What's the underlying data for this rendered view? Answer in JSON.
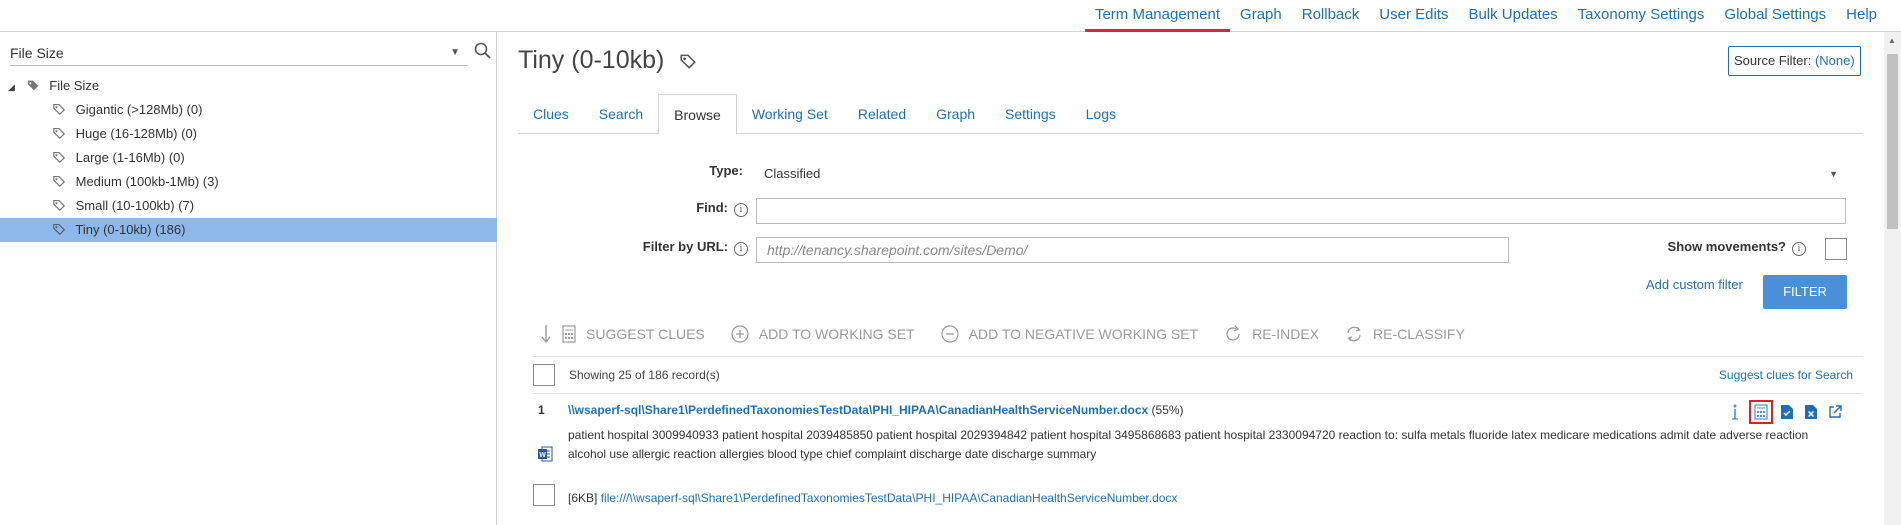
{
  "topnav": {
    "items": [
      "Term Management",
      "Graph",
      "Rollback",
      "User Edits",
      "Bulk Updates",
      "Taxonomy Settings",
      "Global Settings",
      "Help"
    ],
    "active": "Term Management"
  },
  "left": {
    "facet": "File Size",
    "tree": {
      "root": "File Size",
      "children": [
        "Gigantic (>128Mb) (0)",
        "Huge (16-128Mb) (0)",
        "Large (1-16Mb) (0)",
        "Medium (100kb-1Mb) (3)",
        "Small (10-100kb) (7)",
        "Tiny (0-10kb) (186)"
      ],
      "selected": "Tiny (0-10kb) (186)"
    }
  },
  "main": {
    "title": "Tiny (0-10kb)",
    "source_filter_label": "Source Filter:",
    "source_filter_value": "(None)",
    "tabs": [
      "Clues",
      "Search",
      "Browse",
      "Working Set",
      "Related",
      "Graph",
      "Settings",
      "Logs"
    ],
    "active_tab": "Browse",
    "form": {
      "type_label": "Type:",
      "type_value": "Classified",
      "find_label": "Find:",
      "find_value": "",
      "url_label": "Filter by URL:",
      "url_placeholder": "http://tenancy.sharepoint.com/sites/Demo/",
      "movements_label": "Show movements?",
      "add_custom_filter": "Add custom filter",
      "filter_button": "FILTER"
    },
    "actions": [
      "SUGGEST CLUES",
      "ADD TO WORKING SET",
      "ADD TO NEGATIVE WORKING SET",
      "RE-INDEX",
      "RE-CLASSIFY"
    ],
    "results": {
      "showing": "Showing 25 of 186 record(s)",
      "suggest_clues_for_search": "Suggest clues for Search",
      "items": [
        {
          "num": "1",
          "link": "\\\\wsaperf-sql\\Share1\\PerdefinedTaxonomiesTestData\\PHI_HIPAA\\CanadianHealthServiceNumber.docx",
          "pct": "(55%)",
          "text": "patient hospital 3009940933 patient hospital 2039485850 patient hospital 2029394842 patient hospital 3495868683 patient hospital 2330094720 reaction to: sulfa metals fluoride latex medicare medications admit date adverse reaction alcohol use allergic reaction allergies blood type chief complaint discharge date discharge summary",
          "size": "[6KB]",
          "file": "file:///\\\\wsaperf-sql\\Share1\\PerdefinedTaxonomiesTestData\\PHI_HIPAA\\CanadianHealthServiceNumber.docx"
        }
      ]
    }
  }
}
